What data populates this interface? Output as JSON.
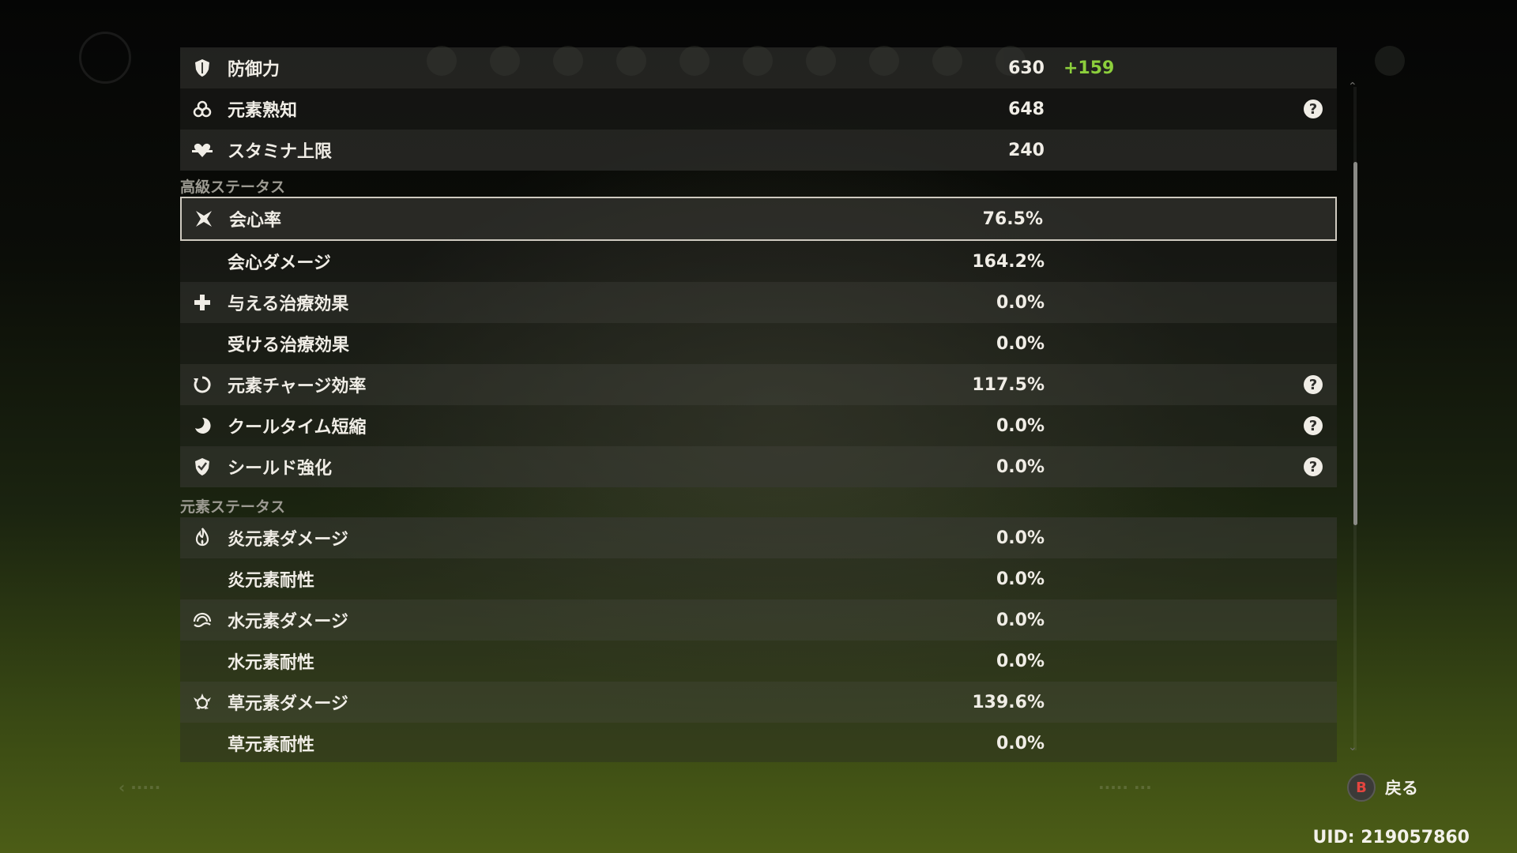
{
  "colors": {
    "bonus_green": "#8ccf3c",
    "text": "#f0ede6",
    "section_text": "#9c9a92",
    "button_b_red": "#e4453f"
  },
  "rows": [
    {
      "label": "防御力",
      "value": "630",
      "bonus": "+159",
      "icon": "shield-icon",
      "help": false
    },
    {
      "label": "元素熟知",
      "value": "648",
      "icon": "elemental-mastery-icon",
      "help": true
    },
    {
      "label": "スタミナ上限",
      "value": "240",
      "icon": "stamina-icon",
      "help": false
    }
  ],
  "sections": {
    "advanced": "高級ステータス",
    "elemental": "元素ステータス"
  },
  "advanced_rows": [
    {
      "label": "会心率",
      "value": "76.5%",
      "icon": "crit-rate-icon",
      "help": false,
      "selected": true
    },
    {
      "label": "会心ダメージ",
      "value": "164.2%",
      "icon": "",
      "help": false
    },
    {
      "label": "与える治療効果",
      "value": "0.0%",
      "icon": "healing-cross-icon",
      "help": false
    },
    {
      "label": "受ける治療効果",
      "value": "0.0%",
      "icon": "",
      "help": false
    },
    {
      "label": "元素チャージ効率",
      "value": "117.5%",
      "icon": "energy-recharge-icon",
      "help": true
    },
    {
      "label": "クールタイム短縮",
      "value": "0.0%",
      "icon": "cooldown-icon",
      "help": true
    },
    {
      "label": "シールド強化",
      "value": "0.0%",
      "icon": "shield-strength-icon",
      "help": true
    }
  ],
  "elemental_rows": [
    {
      "label": "炎元素ダメージ",
      "value": "0.0%",
      "icon": "pyro-icon"
    },
    {
      "label": "炎元素耐性",
      "value": "0.0%",
      "icon": ""
    },
    {
      "label": "水元素ダメージ",
      "value": "0.0%",
      "icon": "hydro-icon"
    },
    {
      "label": "水元素耐性",
      "value": "0.0%",
      "icon": ""
    },
    {
      "label": "草元素ダメージ",
      "value": "139.6%",
      "icon": "dendro-icon"
    },
    {
      "label": "草元素耐性",
      "value": "0.0%",
      "icon": ""
    }
  ],
  "help_glyph": "?",
  "footer": {
    "back_key": "B",
    "back_label": "戻る",
    "uid": "UID: 219057860"
  }
}
